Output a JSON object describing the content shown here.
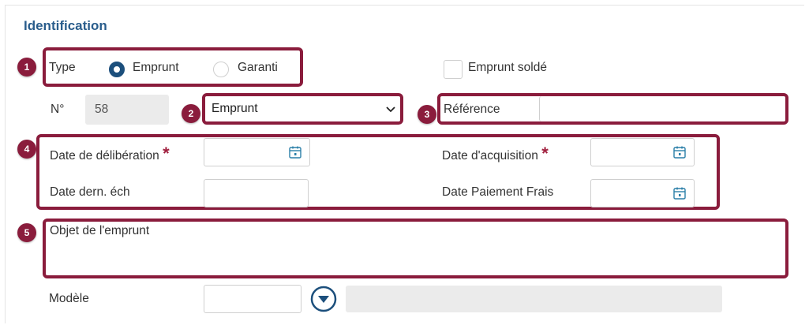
{
  "section": {
    "title": "Identification"
  },
  "badges": [
    "1",
    "2",
    "3",
    "4",
    "5"
  ],
  "type_group": {
    "label": "Type",
    "options": [
      {
        "label": "Emprunt",
        "checked": true
      },
      {
        "label": "Garanti",
        "checked": false
      }
    ]
  },
  "emprunt_solde": {
    "label": "Emprunt soldé",
    "checked": false
  },
  "numero": {
    "label": "N°",
    "value": "58"
  },
  "emprunt_select": {
    "value": "Emprunt"
  },
  "reference": {
    "label": "Référence",
    "value": ""
  },
  "dates": {
    "deliberation": {
      "label": "Date de délibération",
      "required_mark": "*",
      "value": ""
    },
    "acquisition": {
      "label": "Date d'acquisition",
      "required_mark": "*",
      "value": ""
    },
    "dern_ech": {
      "label": "Date dern. éch",
      "value": ""
    },
    "paiement_frais": {
      "label": "Date Paiement Frais",
      "value": ""
    }
  },
  "objet": {
    "label": "Objet de l'emprunt",
    "value": ""
  },
  "modele": {
    "label": "Modèle",
    "value": "",
    "description": ""
  },
  "icons": {
    "calendar": "calendar-icon",
    "dropdown": "chevron-down-icon",
    "expand": "expand-circle-icon"
  },
  "colors": {
    "accent": "#8a1c3c",
    "title": "#2a5d8c",
    "radio": "#1c4f7c"
  }
}
